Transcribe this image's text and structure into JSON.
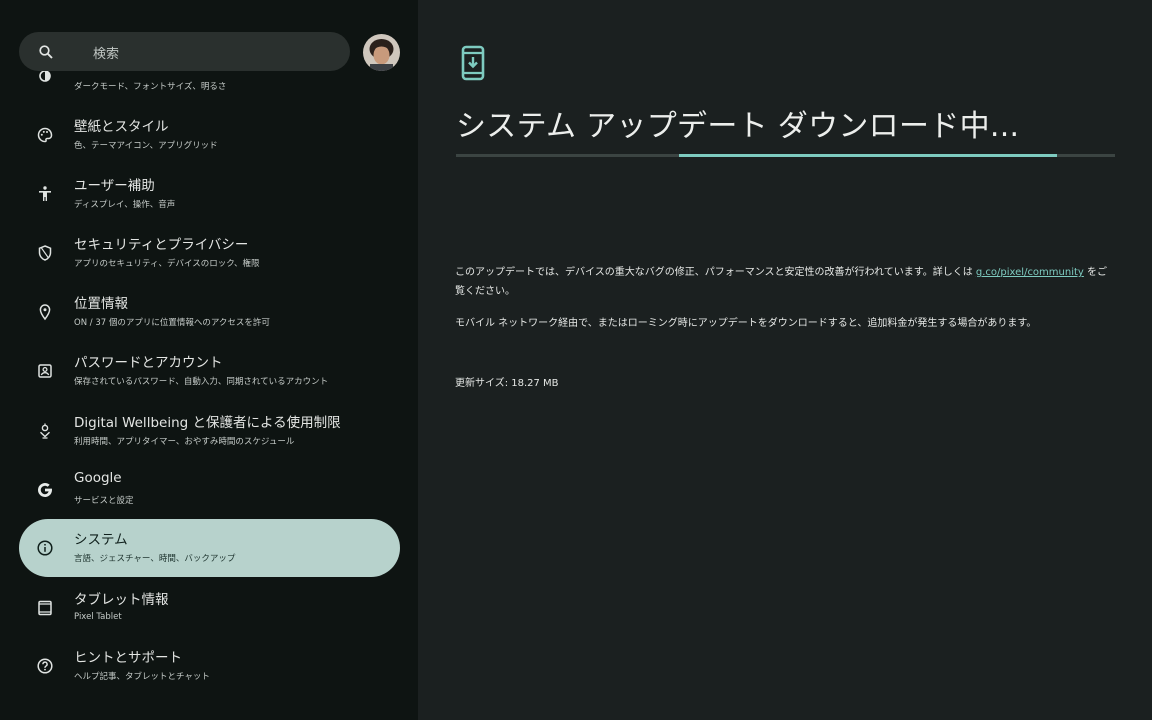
{
  "search": {
    "placeholder": "検索"
  },
  "sidebar": {
    "items": [
      {
        "title": "",
        "sub": "ダークモード、フォントサイズ、明るさ",
        "icon": "display-icon"
      },
      {
        "title": "壁紙とスタイル",
        "sub": "色、テーマアイコン、アプリグリッド",
        "icon": "palette-icon"
      },
      {
        "title": "ユーザー補助",
        "sub": "ディスプレイ、操作、音声",
        "icon": "accessibility-icon"
      },
      {
        "title": "セキュリティとプライバシー",
        "sub": "アプリのセキュリティ、デバイスのロック、権限",
        "icon": "shield-icon"
      },
      {
        "title": "位置情報",
        "sub": "ON / 37 個のアプリに位置情報へのアクセスを許可",
        "icon": "location-pin-icon"
      },
      {
        "title": "パスワードとアカウント",
        "sub": "保存されているパスワード、自動入力、同期されているアカウント",
        "icon": "account-box-icon"
      },
      {
        "title": "Digital Wellbeing と保護者による使用制限",
        "sub": "利用時間、アプリタイマー、おやすみ時間のスケジュール",
        "icon": "wellbeing-icon"
      },
      {
        "title": "Google",
        "sub": "サービスと設定",
        "icon": "google-g-icon"
      },
      {
        "title": "システム",
        "sub": "言語、ジェスチャー、時間、バックアップ",
        "icon": "info-icon",
        "selected": true
      },
      {
        "title": "タブレット情報",
        "sub": "Pixel Tablet",
        "icon": "tablet-icon"
      },
      {
        "title": "ヒントとサポート",
        "sub": "ヘルプ記事、タブレットとチャット",
        "icon": "help-icon"
      }
    ]
  },
  "detail": {
    "icon": "system-update-icon",
    "title": "システム アップデート ダウンロード中...",
    "progress": {
      "segment_start_fraction": 0.339,
      "segment_end_fraction": 0.912
    },
    "paragraph1_before_link": "このアップデートでは、デバイスの重大なバグの修正、パフォーマンスと安定性の改善が行われています。詳しくは ",
    "paragraph1_link": "g.co/pixel/community",
    "paragraph1_after_link": " をご覧ください。",
    "paragraph2": "モバイル ネットワーク経由で、またはローミング時にアップデートをダウンロードすると、追加料金が発生する場合があります。",
    "update_size": "更新サイズ: 18.27 MB"
  },
  "colors": {
    "accent": "#7ecbc0",
    "selected_item_bg": "#b7d2cc",
    "left_bg": "#0e1412",
    "right_bg": "#1b2020"
  }
}
